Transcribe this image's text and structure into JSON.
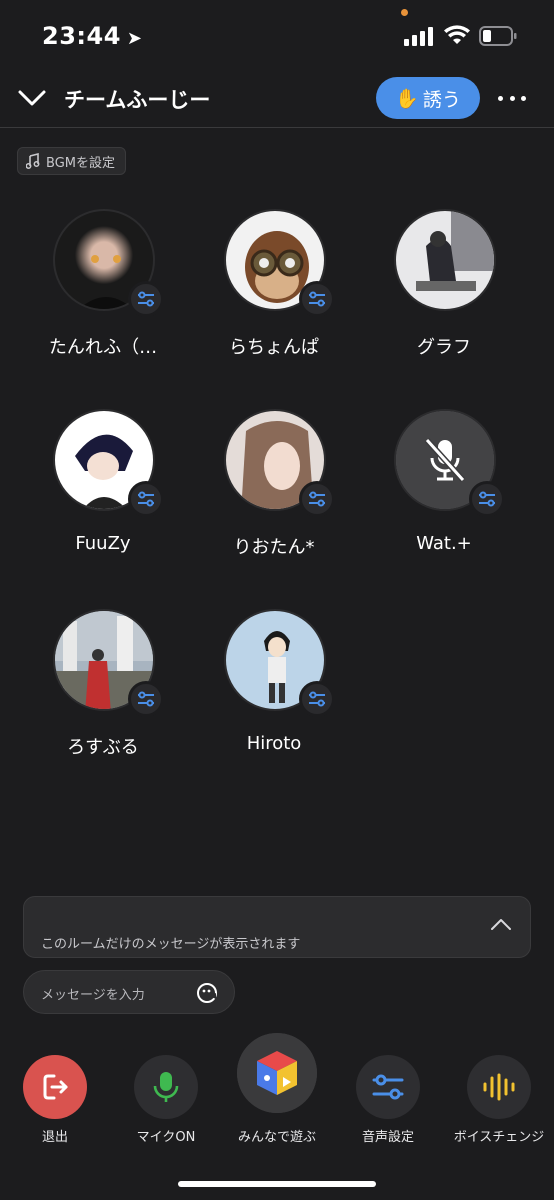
{
  "status_bar": {
    "time": "23:44",
    "accent_dot_color": "#e8933a"
  },
  "header": {
    "title": "チームふーじー",
    "invite_label": "誘う",
    "invite_icon": "raised-hand-emoji",
    "accent_color": "#4a8fe8"
  },
  "bgm": {
    "label": "BGMを設定",
    "icon": "music-note-icon"
  },
  "participants": [
    {
      "name": "たんれふ（…",
      "muted": false
    },
    {
      "name": "らちょんぱ",
      "muted": false
    },
    {
      "name": "グラフ",
      "muted": false
    },
    {
      "name": "FuuZy",
      "muted": false
    },
    {
      "name": "りおたん*",
      "muted": false
    },
    {
      "name": "Wat.+",
      "muted": true
    },
    {
      "name": "ろすぶる",
      "muted": false
    },
    {
      "name": "Hiroto",
      "muted": false
    }
  ],
  "messages": {
    "notice": "このルームだけのメッセージが表示されます",
    "input_placeholder": "メッセージを入力"
  },
  "toolbar": [
    {
      "label": "退出",
      "icon": "exit-icon",
      "color": "#d9534f"
    },
    {
      "label": "マイクON",
      "icon": "microphone-icon",
      "color": "#3fb950"
    },
    {
      "label": "みんなで遊ぶ",
      "icon": "games-cube-icon"
    },
    {
      "label": "音声設定",
      "icon": "sliders-icon",
      "color": "#4a8fe8"
    },
    {
      "label": "ボイスチェンジ",
      "icon": "waveform-icon",
      "color": "#f2c230"
    }
  ]
}
